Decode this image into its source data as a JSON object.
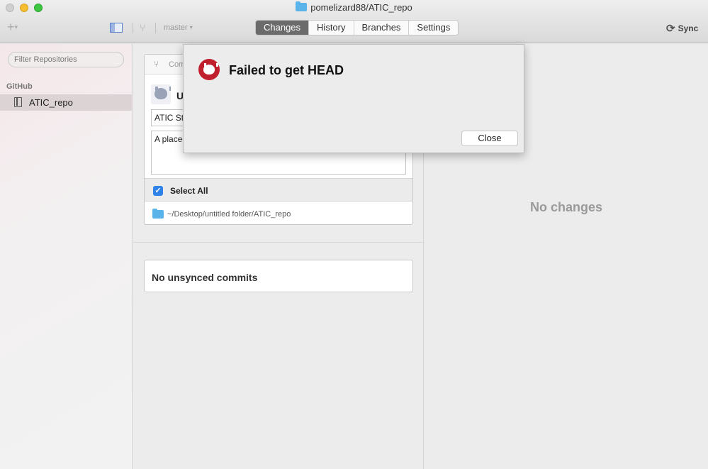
{
  "window": {
    "title": "pomelizard88/ATIC_repo"
  },
  "toolbar": {
    "branch_label": "master",
    "tabs": [
      {
        "label": "Changes",
        "active": true
      },
      {
        "label": "History",
        "active": false
      },
      {
        "label": "Branches",
        "active": false
      },
      {
        "label": "Settings",
        "active": false
      }
    ],
    "sync_label": "Sync"
  },
  "sidebar": {
    "filter_placeholder": "Filter Repositories",
    "section_label": "GitHub",
    "repos": [
      {
        "name": "ATIC_repo",
        "selected": true
      }
    ]
  },
  "commit": {
    "header_label": "Com",
    "user_initial": "U",
    "summary_value": "ATIC St",
    "description_value": "A place",
    "select_all_label": "Select All",
    "select_all_checked": true,
    "path": "~/Desktop/untitled folder/ATIC_repo"
  },
  "history": {
    "unsynced_label": "No unsynced commits"
  },
  "diff": {
    "empty_label": "No changes"
  },
  "dialog": {
    "title": "Failed to get HEAD",
    "close_label": "Close",
    "icon": "github-octocat-icon",
    "accent_color": "#c0202e"
  }
}
